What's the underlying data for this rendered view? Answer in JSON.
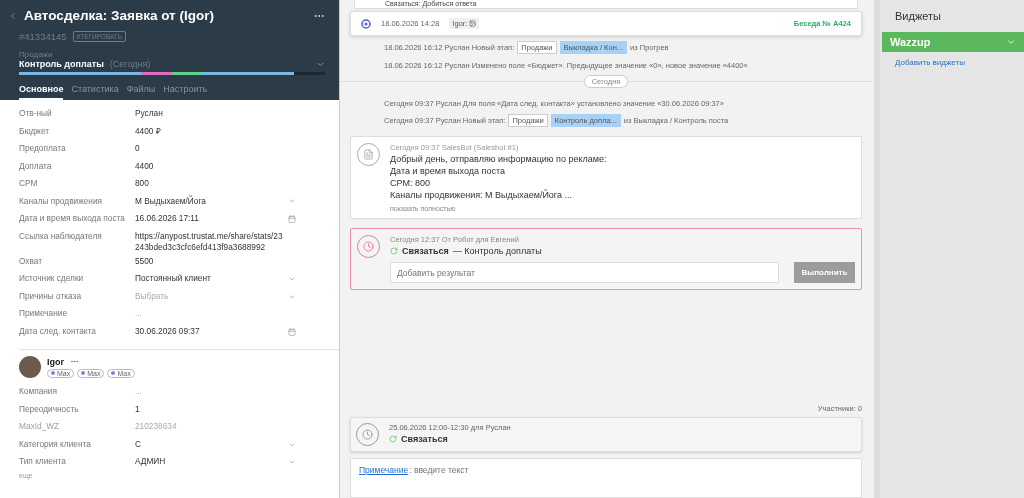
{
  "deal": {
    "title": "Автосделка: Заявка от (Igor)",
    "id": "#41334145",
    "tag_button": "#ТЕГИРОВАТЬ",
    "pipeline": "Продажи",
    "status": "Контроль доплаты",
    "status_date": "(Сегодня)",
    "level": 0.9
  },
  "tabs": [
    {
      "label": "Основное",
      "selected": true
    },
    {
      "label": "Статистика",
      "selected": false
    },
    {
      "label": "Файлы",
      "selected": false
    },
    {
      "label": "Настроить",
      "selected": false
    }
  ],
  "fields": [
    {
      "label": "Отв-ный",
      "value": "Руслан",
      "kind": "text"
    },
    {
      "label": "Бюджет",
      "value": "4400 ₽",
      "kind": "text"
    },
    {
      "label": "Предоплата",
      "value": "0",
      "kind": "text"
    },
    {
      "label": "Доплата",
      "value": "4400",
      "kind": "text"
    },
    {
      "label": "CPM",
      "value": "800",
      "kind": "text"
    },
    {
      "label": "Каналы продвижения",
      "value": "М Выдыхаем/Йога",
      "kind": "select"
    },
    {
      "label": "Дата и время выхода поста",
      "value": "16.06.2026 17:11",
      "kind": "date"
    },
    {
      "label": "Ссылка наблюдателя",
      "value": "https://anypost.trustat.me/share/stats/23243bded3c3cfc6efd413f9a3688992",
      "kind": "text"
    },
    {
      "label": "Охват",
      "value": "5500",
      "kind": "text"
    },
    {
      "label": "Источник сделки",
      "value": "Постоянный клиент",
      "kind": "select"
    },
    {
      "label": "Причины отказа",
      "placeholder": "Выбрать",
      "kind": "select"
    },
    {
      "label": "Примечание",
      "value": "...",
      "kind": "empty"
    },
    {
      "label": "Дата след. контакта",
      "value": "30.06.2026 09:37",
      "kind": "date"
    }
  ],
  "contact": {
    "name": "Igor",
    "tags": [
      "Max",
      "Max",
      "Max"
    ],
    "fields": [
      {
        "label": "Компания",
        "value": "...",
        "kind": "empty"
      },
      {
        "label": "Переодичность",
        "value": "1",
        "kind": "text"
      },
      {
        "label": "MaxId_WZ",
        "value": "210238634",
        "kind": "readonly"
      },
      {
        "label": "Категория клиента",
        "value": "C",
        "kind": "select"
      },
      {
        "label": "Тип клиента",
        "value": "АДМИН",
        "kind": "select"
      }
    ],
    "more": "еще"
  },
  "feed": [
    {
      "kind": "cut",
      "text": "Связаться: Добиться ответа"
    },
    {
      "kind": "chat",
      "time": "18.06.2026 14:28",
      "author": "Igor:",
      "conversation": "Беседа № A424"
    },
    {
      "kind": "stage",
      "text": "18.06.2026 16:12 Руслан Новый этап:",
      "pipeline": "Продажи",
      "status": "Выкладка / Кон...",
      "suffix": "из Прогрев"
    },
    {
      "kind": "event",
      "text": "18.06.2026 16:12 Руслан Изменено поле «Бюджет». Предыдущее значение «0», новое значение «4400»"
    },
    {
      "kind": "divider",
      "text": "Сегодня"
    },
    {
      "kind": "event",
      "text": "Сегодня 09:37 Руслан Для поля «Дата след. контакта» установлено значение «30.06.2026 09:37»"
    },
    {
      "kind": "stage",
      "text": "Сегодня 09:37 Руслан Новый этап:",
      "pipeline": "Продажи",
      "status": "Контроль допла...",
      "suffix": "из Выкладка / Контроль поста"
    },
    {
      "kind": "message",
      "meta": "Сегодня 09:37 SalesBot (Salesbot #1)",
      "lines": [
        "Добрый день, отправляю информацию по рекламе:",
        "Дата и время выхода поста",
        "CPM: 800",
        "Каналы продвижения: М Выдыхаем/Йога ..."
      ],
      "more": "показать полностью"
    },
    {
      "kind": "task",
      "meta": "Сегодня 12:37 От Робот для Евгений",
      "type": "Связаться",
      "text": "— Контроль доплаты",
      "placeholder": "Добавить результат",
      "button": "Выполнить"
    }
  ],
  "participants": "Участники: 0",
  "planned": {
    "meta": "25.06.2026 12:00-12:30 для Руслан",
    "type": "Связаться"
  },
  "note": {
    "link": "Примечание",
    "placeholder": ": введите текст"
  },
  "widgets": {
    "title": "Виджеты",
    "items": [
      "Wazzup"
    ],
    "add": "Добавить виджеты"
  }
}
